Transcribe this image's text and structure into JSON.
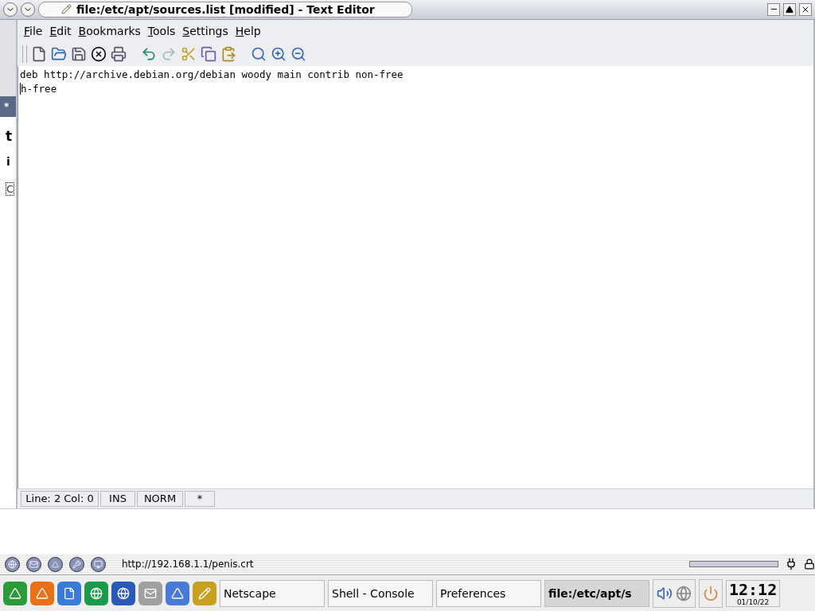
{
  "window": {
    "title": "file:/etc/apt/sources.list [modified] - Text Editor"
  },
  "background_window": {
    "tab": "*",
    "heading": "t",
    "text": "i",
    "link": "C"
  },
  "menu": [
    "File",
    "Edit",
    "Bookmarks",
    "Tools",
    "Settings",
    "Help"
  ],
  "toolbar": [
    {
      "kind": "new"
    },
    {
      "kind": "open"
    },
    {
      "kind": "save"
    },
    {
      "kind": "close"
    },
    {
      "kind": "print"
    },
    {
      "kind": "sep"
    },
    {
      "kind": "undo"
    },
    {
      "kind": "redo",
      "disabled": true
    },
    {
      "kind": "cut"
    },
    {
      "kind": "copy"
    },
    {
      "kind": "paste"
    },
    {
      "kind": "sep"
    },
    {
      "kind": "find"
    },
    {
      "kind": "zoom-in"
    },
    {
      "kind": "zoom-out"
    }
  ],
  "document": {
    "lines": [
      "deb http://archive.debian.org/debian woody main contrib non-free",
      "h-free"
    ]
  },
  "status_bar": [
    "Line: 2 Col: 0",
    "INS",
    "NORM",
    "*"
  ],
  "browser_bar": {
    "url": "http://192.168.1.1/penis.crt"
  },
  "taskbar": {
    "tasks": [
      {
        "label": "Netscape",
        "selected": false
      },
      {
        "label": "Shell - Console",
        "selected": false
      },
      {
        "label": "Preferences",
        "selected": false
      },
      {
        "label": "file:/etc/apt/s",
        "selected": true
      }
    ],
    "clock": "12:12",
    "date": "01/10/22"
  }
}
